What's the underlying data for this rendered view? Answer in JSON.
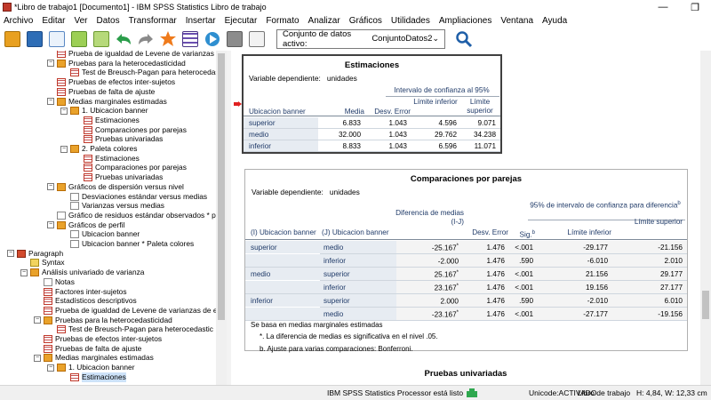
{
  "window": {
    "title": "*Libro de trabajo1 [Documento1] - IBM SPSS Statistics Libro de trabajo",
    "min_icon": "minimize-icon",
    "max_icon": "maximize-icon",
    "min_glyph": "—",
    "max_glyph": "❐"
  },
  "menu": [
    "Archivo",
    "Editar",
    "Ver",
    "Datos",
    "Transformar",
    "Insertar",
    "Ejecutar",
    "Formato",
    "Analizar",
    "Gráficos",
    "Utilidades",
    "Ampliaciones",
    "Ventana",
    "Ayuda"
  ],
  "toolbar": {
    "icons": [
      "open-folder-icon",
      "save-icon",
      "print-preview-icon",
      "export-icon",
      "insert-icon",
      "undo-icon",
      "redo-icon",
      "goto-data-icon",
      "variables-icon",
      "run-icon",
      "stop-icon",
      "designate-window-icon"
    ],
    "dataset_label": "Conjunto de datos activo:",
    "dataset_value": "ConjuntoDatos2",
    "search_icon": "search-icon"
  },
  "outline": {
    "nodes": [
      {
        "text": "Prueba de igualdad de Levene de varianzas de e",
        "exp": "",
        "icon": "tbl"
      },
      {
        "text": "Pruebas para la heterocedasticidad",
        "exp": "−",
        "icon": "book"
      },
      {
        "text": "Test de Breusch-Pagan para heterocedastic",
        "exp": "",
        "icon": "tbl"
      },
      {
        "text": "Pruebas de efectos inter-sujetos",
        "exp": "",
        "icon": "tbl"
      },
      {
        "text": "Pruebas de falta de ajuste",
        "exp": "",
        "icon": "tbl"
      },
      {
        "text": "Medias marginales estimadas",
        "exp": "−",
        "icon": "book"
      },
      {
        "text": "1. Ubicacion banner",
        "exp": "−",
        "icon": "book"
      },
      {
        "text": "Estimaciones",
        "exp": "",
        "icon": "tbl"
      },
      {
        "text": "Comparaciones por parejas",
        "exp": "",
        "icon": "tbl"
      },
      {
        "text": "Pruebas univariadas",
        "exp": "",
        "icon": "tbl"
      },
      {
        "text": "2. Paleta colores",
        "exp": "−",
        "icon": "book"
      },
      {
        "text": "Estimaciones",
        "exp": "",
        "icon": "tbl"
      },
      {
        "text": "Comparaciones por parejas",
        "exp": "",
        "icon": "tbl"
      },
      {
        "text": "Pruebas univariadas",
        "exp": "",
        "icon": "tbl"
      },
      {
        "text": "Gráficos de dispersión versus nivel",
        "exp": "−",
        "icon": "book"
      },
      {
        "text": "Desviaciones estándar versus medias",
        "exp": "",
        "icon": "chart"
      },
      {
        "text": "Varianzas versus medias",
        "exp": "",
        "icon": "chart"
      },
      {
        "text": "Gráfico de residuos estándar observados * pronc",
        "exp": "",
        "icon": "chart"
      },
      {
        "text": "Gráficos de perfil",
        "exp": "−",
        "icon": "book"
      },
      {
        "text": "Ubicacion banner",
        "exp": "",
        "icon": "chart"
      },
      {
        "text": "Ubicacion banner * Paleta colores",
        "exp": "",
        "icon": "chart"
      },
      {
        "text": "Paragraph",
        "exp": "−",
        "icon": "bookr"
      },
      {
        "text": "Syntax",
        "exp": "",
        "icon": "syn"
      },
      {
        "text": "Análisis univariado de varianza",
        "exp": "−",
        "icon": "book"
      },
      {
        "text": "Notas",
        "exp": "",
        "icon": "doc"
      },
      {
        "text": "Factores inter-sujetos",
        "exp": "",
        "icon": "tbl"
      },
      {
        "text": "Estadísticos descriptivos",
        "exp": "",
        "icon": "tbl"
      },
      {
        "text": "Prueba de igualdad de Levene de varianzas de e",
        "exp": "",
        "icon": "tbl"
      },
      {
        "text": "Pruebas para la heterocedasticidad",
        "exp": "−",
        "icon": "book"
      },
      {
        "text": "Test de Breusch-Pagan para heterocedastic",
        "exp": "",
        "icon": "tbl"
      },
      {
        "text": "Pruebas de efectos inter-sujetos",
        "exp": "",
        "icon": "tbl"
      },
      {
        "text": "Pruebas de falta de ajuste",
        "exp": "",
        "icon": "tbl"
      },
      {
        "text": "Medias marginales estimadas",
        "exp": "−",
        "icon": "book"
      },
      {
        "text": "1. Ubicacion banner",
        "exp": "−",
        "icon": "book"
      },
      {
        "text": "Estimaciones",
        "exp": "",
        "icon": "tbl",
        "selected": true
      }
    ]
  },
  "estimaciones": {
    "title": "Estimaciones",
    "depvar_label": "Variable dependiente:",
    "depvar_value": "unidades",
    "ci_header": "Intervalo de confianza al 95%",
    "headers": [
      "Ubicacion banner",
      "Media",
      "Desv. Error",
      "Límite inferior",
      "Límite superior"
    ],
    "rows": [
      [
        "superior",
        "6.833",
        "1.043",
        "4.596",
        "9.071"
      ],
      [
        "medio",
        "32.000",
        "1.043",
        "29.762",
        "34.238"
      ],
      [
        "inferior",
        "8.833",
        "1.043",
        "6.596",
        "11.071"
      ]
    ]
  },
  "comparaciones": {
    "title": "Comparaciones por parejas",
    "depvar_label": "Variable dependiente:",
    "depvar_value": "unidades",
    "ci_header": "95% de intervalo de confianza para diferencia",
    "ci_sup": "b",
    "headers": [
      "(I) Ubicacion banner",
      "(J) Ubicacion banner",
      "Diferencia de medias (I-J)",
      "Desv. Error",
      "Sig.",
      "Límite inferior",
      "Límite superior"
    ],
    "sig_sup": "b",
    "rows": [
      [
        "superior",
        "medio",
        "-25.167",
        "*",
        "1.476",
        "<.001",
        "-29.177",
        "-21.156"
      ],
      [
        "",
        "inferior",
        "-2.000",
        "",
        "1.476",
        ".590",
        "-6.010",
        "2.010"
      ],
      [
        "medio",
        "superior",
        "25.167",
        "*",
        "1.476",
        "<.001",
        "21.156",
        "29.177"
      ],
      [
        "",
        "inferior",
        "23.167",
        "*",
        "1.476",
        "<.001",
        "19.156",
        "27.177"
      ],
      [
        "inferior",
        "superior",
        "2.000",
        "",
        "1.476",
        ".590",
        "-2.010",
        "6.010"
      ],
      [
        "",
        "medio",
        "-23.167",
        "*",
        "1.476",
        "<.001",
        "-27.177",
        "-19.156"
      ]
    ],
    "notes": [
      "Se basa en medias marginales estimadas",
      "*. La diferencia de medias es significativa en el nivel .05.",
      "b. Ajuste para varias comparaciones: Bonferroni."
    ]
  },
  "next_title": "Pruebas univariadas",
  "status": {
    "processor": "IBM SPSS Statistics Processor está listo",
    "unicode": "Unicode:ACTIVADO",
    "workbook": "Libro de trabajo",
    "position": "H: 4,84, W: 12,33 cm"
  }
}
